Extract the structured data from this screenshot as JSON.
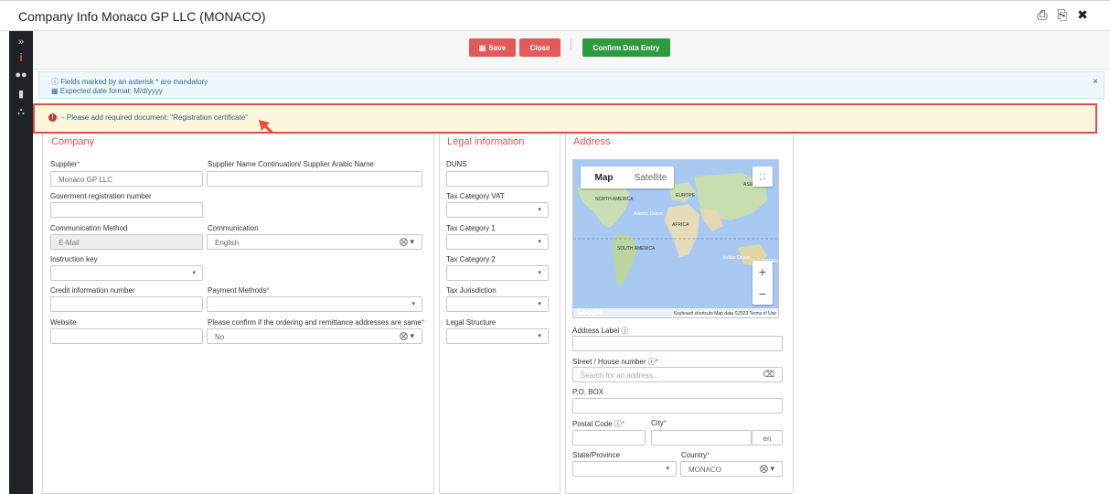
{
  "window": {
    "title": "Company Info Monaco GP LLC (MONACO)",
    "icons": [
      "print-icon",
      "print-alt-icon",
      "close-icon"
    ]
  },
  "sidebar": {
    "expand": "»",
    "info": "i",
    "users": "users-icon",
    "book": "book-icon",
    "cart": "cart-icon"
  },
  "toolbar": {
    "save_label": "Save",
    "close_label": "Close",
    "confirm_label": "Confirm Data Entry"
  },
  "info": {
    "line1": "Fields marked by an asterisk * are mandatory",
    "line2": "Expected date format: M/d/yyyy",
    "close": "×"
  },
  "warning": {
    "icon": "!",
    "message": "- Please add required document: \"Registration certificate\""
  },
  "company": {
    "title": "Company",
    "supplier_label": "Supplier",
    "supplier_value": "Monaco GP LLC",
    "continuation_label": "Supplier Name Continuation/ Supplier Arabic Name",
    "continuation_value": "",
    "gov_reg_label": "Goverment registration number",
    "gov_reg_value": "",
    "comm_method_label": "Communication Method",
    "comm_method_value": "E-Mail",
    "communication_label": "Communication",
    "communication_value": "English",
    "instruction_key_label": "Instruction key",
    "instruction_key_value": "",
    "credit_info_label": "Credit information number",
    "credit_info_value": "",
    "payment_methods_label": "Payment Methods",
    "payment_methods_value": "",
    "website_label": "Website",
    "website_value": "",
    "confirm_addr_label": "Please confirm if the ordering and remittance addresses are same",
    "confirm_addr_value": "No"
  },
  "legal": {
    "title": "Legal information",
    "duns_label": "DUNS",
    "tax_vat_label": "Tax Category VAT",
    "tax1_label": "Tax Category 1",
    "tax2_label": "Tax Category 2",
    "tax_juris_label": "Tax Jurisdiction",
    "legal_struct_label": "Legal Structure"
  },
  "address": {
    "title": "Address",
    "map_tab_map": "Map",
    "map_tab_satellite": "Satellite",
    "map_google": "Google",
    "map_footer": "Keyboard shortcuts   Map data ©2023   Terms of Use",
    "map_labels": {
      "north_america": "NORTH AMERICA",
      "europe": "EUROPE",
      "asia": "ASIA",
      "africa": "AFRICA",
      "south_america": "SOUTH AMERICA",
      "atlantic": "Atlantic Ocean",
      "indian": "Indian Ocean",
      "ocean": "OCEAN"
    },
    "address_label_label": "Address Label",
    "address_label_value": "",
    "street_label": "Street / House number",
    "street_placeholder": "Search for an address...",
    "pobox_label": "P.O. BOX",
    "postal_label": "Postal Code",
    "city_label": "City",
    "city_lang": "en",
    "state_label": "State/Province",
    "country_label": "Country",
    "country_value": "MONACO"
  }
}
